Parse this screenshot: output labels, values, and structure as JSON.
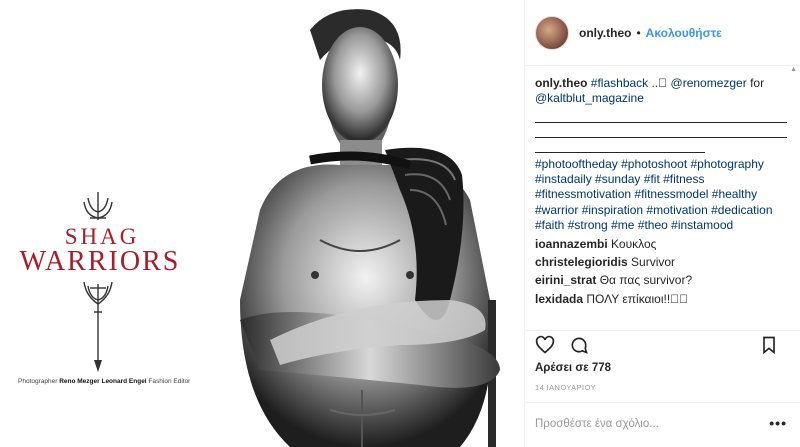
{
  "photo": {
    "title_line1": "SHAG",
    "title_line2": "WARRIORS",
    "credit_label1": "Photographer",
    "credit_name1": "Reno Mezger",
    "credit_name2": "Leonard Engel",
    "credit_label2": "Fashion Editor"
  },
  "header": {
    "username": "only.theo",
    "dot": "•",
    "follow_label": "Ακολουθήστε"
  },
  "caption": {
    "username": "only.theo",
    "tag_flashback": "#flashback",
    "text_dots": " ..⃞ ",
    "mention1": "@renomezger",
    "text_for": " for",
    "mention2": "@kaltblut_magazine",
    "hashtags": [
      "#photooftheday",
      "#photoshoot",
      "#photography",
      "#instadaily",
      "#sunday",
      "#fit",
      "#fitness",
      "#fitnessmotivation",
      "#fitnessmodel",
      "#healthy",
      "#warrior",
      "#inspiration",
      "#motivation",
      "#dedication",
      "#faith",
      "#strong",
      "#me",
      "#theo",
      "#instamood"
    ]
  },
  "comments": [
    {
      "user": "ioannazembi",
      "text": "Κουκλος"
    },
    {
      "user": "christelegioridis",
      "text": "Survivor"
    },
    {
      "user": "eirini_strat",
      "text": "Θα πας survivor?"
    },
    {
      "user": "lexidada",
      "text": "ΠΟΛΥ επίκαιοι!!⃞⃞"
    }
  ],
  "stats": {
    "likes": "Αρέσει σε 778",
    "date": "14 ΙΑΝΟΥΑΡΙΟΥ"
  },
  "add_comment": {
    "placeholder": "Προσθέστε ένα σχόλιο...",
    "more_label": "•••"
  },
  "icons": {
    "like": "heart-icon",
    "comment": "comment-icon",
    "save": "bookmark-icon"
  }
}
